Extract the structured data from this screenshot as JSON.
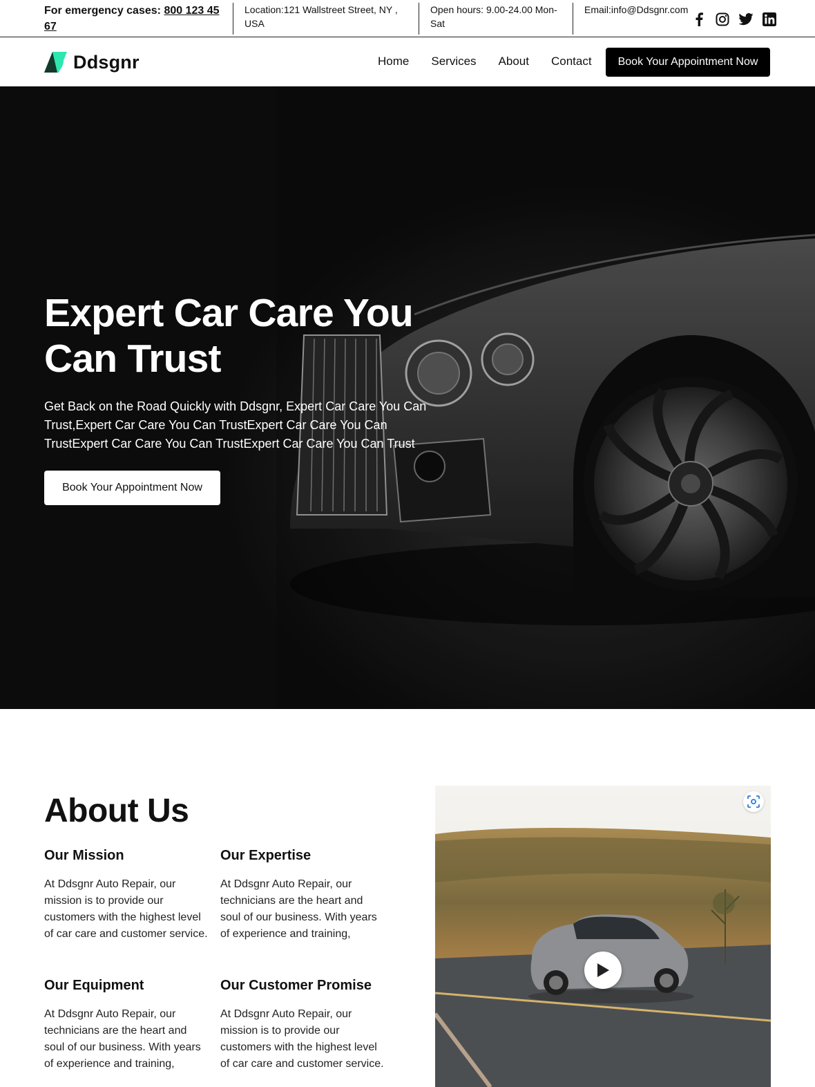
{
  "topbar": {
    "emergency_label": "For emergency cases:",
    "emergency_phone": "800 123 45 67",
    "location": "Location:121 Wallstreet Street, NY , USA",
    "hours": "Open hours: 9.00-24.00 Mon-Sat",
    "email": "Email:info@Ddsgnr.com",
    "socials": [
      "facebook-icon",
      "instagram-icon",
      "twitter-icon",
      "linkedin-icon"
    ]
  },
  "nav": {
    "brand": "Ddsgnr",
    "links": [
      "Home",
      "Services",
      "About",
      "Contact"
    ],
    "cta": "Book Your Appointment Now"
  },
  "hero": {
    "title": "Expert Car Care You Can Trust",
    "subtitle": "Get Back on the Road Quickly with Ddsgnr, Expert Car Care You Can Trust,Expert Car Care You Can TrustExpert Car Care You Can TrustExpert Car Care You Can TrustExpert Car Care You Can Trust",
    "cta": "Book Your Appointment Now"
  },
  "about": {
    "title": "About Us",
    "cards": [
      {
        "heading": "Our Mission",
        "text": "At Ddsgnr Auto Repair, our mission is to provide our customers with the highest level of car care and customer service."
      },
      {
        "heading": "Our Expertise",
        "text": "At Ddsgnr Auto Repair, our technicians are the heart and soul of our business. With years of experience and training,"
      },
      {
        "heading": "Our Equipment",
        "text": "At Ddsgnr Auto Repair, our technicians are the heart and soul of our business. With years of experience and training,"
      },
      {
        "heading": "Our Customer Promise",
        "text": "At Ddsgnr Auto Repair, our mission is to provide our customers with the highest level of car care and customer service."
      }
    ]
  },
  "colors": {
    "brand_accent": "#2ee6b0",
    "dark": "#000000"
  }
}
